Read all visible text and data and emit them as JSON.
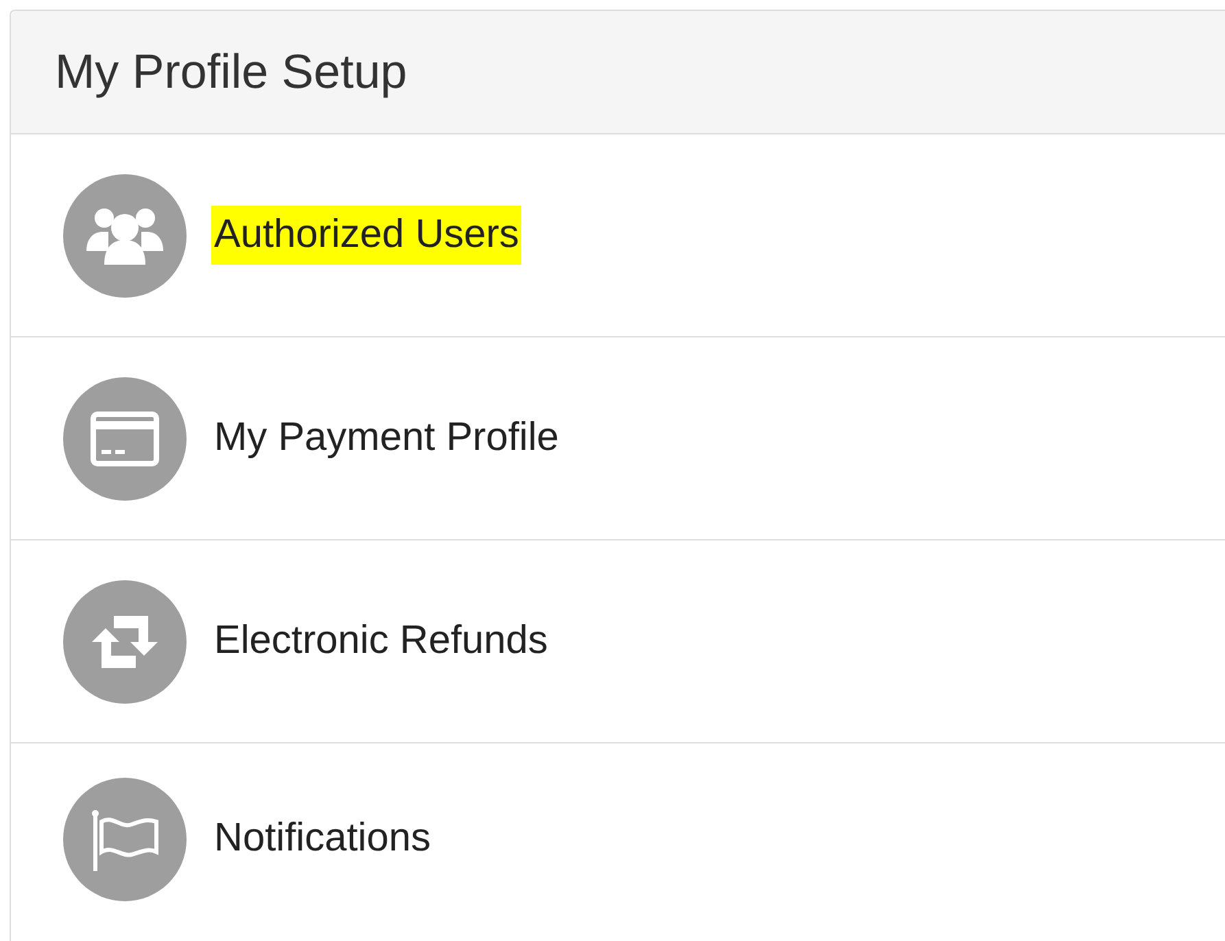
{
  "panel": {
    "title": "My Profile Setup"
  },
  "items": [
    {
      "kind": "users",
      "label": "Authorized Users",
      "highlighted": true
    },
    {
      "kind": "card",
      "label": "My Payment Profile",
      "highlighted": false
    },
    {
      "kind": "exchange",
      "label": "Electronic Refunds",
      "highlighted": false
    },
    {
      "kind": "flag",
      "label": "Notifications",
      "highlighted": false
    }
  ]
}
